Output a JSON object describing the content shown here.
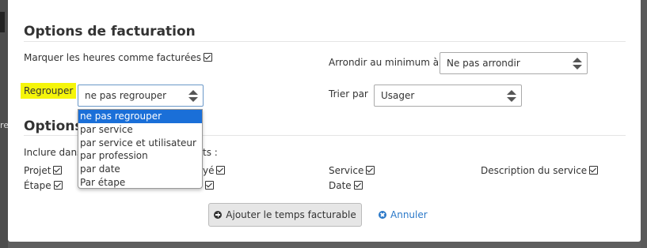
{
  "billing": {
    "title": "Options de facturation",
    "mark_hours_label": "Marquer les heures comme facturées",
    "round_label": "Arrondir au minimum à",
    "round_value": "Ne pas arrondir",
    "group_label": "Regrouper",
    "group_value": "ne pas regrouper",
    "group_options": [
      "ne pas regrouper",
      "par service",
      "par service et utilisateur",
      "par profession",
      "par date",
      "Par étape"
    ],
    "sort_label": "Trier par",
    "sort_value": "Usager"
  },
  "options": {
    "title": "Options",
    "include_prefix": "Inclure dans",
    "include_suffix": "ts :",
    "fields": {
      "projet": "Projet",
      "etape": "Étape",
      "paye_fragment": "yé",
      "service": "Service",
      "date": "Date",
      "description": "Description du service"
    }
  },
  "actions": {
    "add_label": "Ajouter le temps facturable",
    "cancel_label": "Annuler"
  },
  "background": {
    "side_fragment": "re"
  },
  "colors": {
    "highlight": "#f5f50a",
    "dropdown_selected": "#1a6fd8",
    "link": "#2a78c8"
  }
}
